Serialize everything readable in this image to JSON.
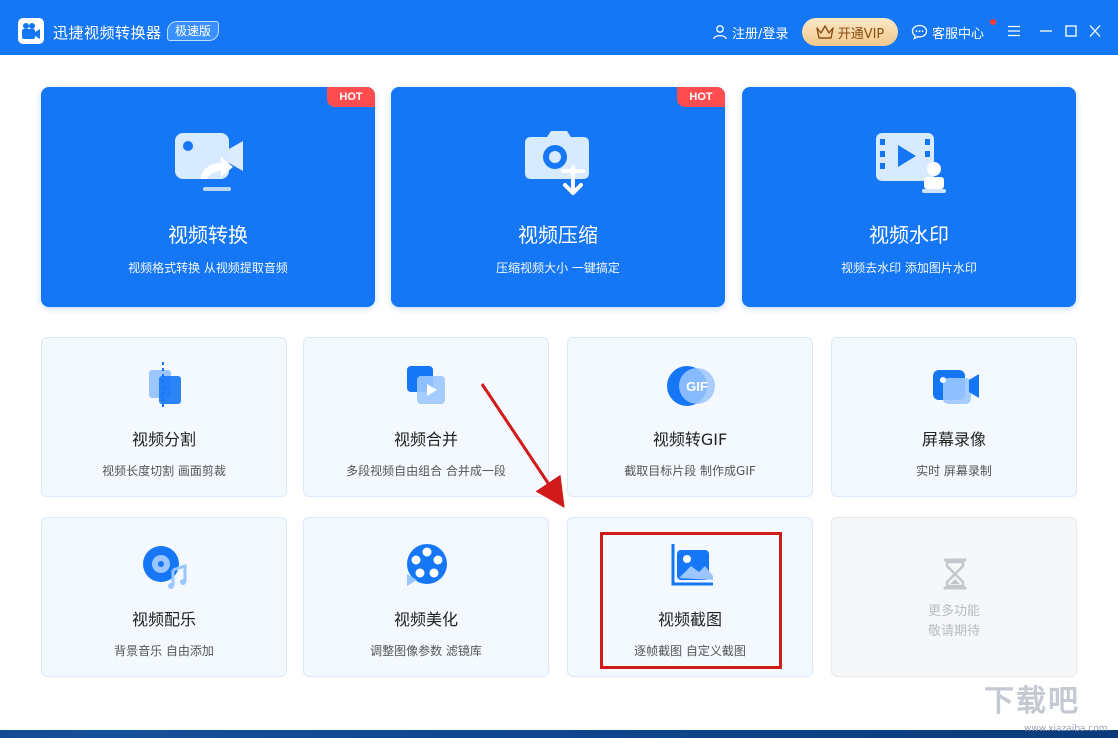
{
  "titlebar": {
    "app_name": "迅捷视频转换器",
    "badge": "极速版",
    "login": "注册/登录",
    "vip": "开通VIP",
    "service": "客服中心"
  },
  "big_cards": [
    {
      "title": "视频转换",
      "desc": "视频格式转换 从视频提取音频",
      "hot": "HOT"
    },
    {
      "title": "视频压缩",
      "desc": "压缩视频大小 一键搞定",
      "hot": "HOT"
    },
    {
      "title": "视频水印",
      "desc": "视频去水印 添加图片水印"
    }
  ],
  "small_cards": [
    {
      "title": "视频分割",
      "desc": "视频长度切割 画面剪裁"
    },
    {
      "title": "视频合并",
      "desc": "多段视频自由组合 合并成一段"
    },
    {
      "title": "视频转GIF",
      "desc": "截取目标片段 制作成GIF",
      "icon_text": "GIF"
    },
    {
      "title": "屏幕录像",
      "desc": "实时 屏幕录制"
    },
    {
      "title": "视频配乐",
      "desc": "背景音乐 自由添加"
    },
    {
      "title": "视频美化",
      "desc": "调整图像参数 滤镜库"
    },
    {
      "title": "视频截图",
      "desc": "逐帧截图 自定义截图"
    }
  ],
  "more": {
    "line1": "更多功能",
    "line2": "敬请期待"
  },
  "watermark": {
    "text": "下载吧",
    "url": "www.xiazaiba.com"
  },
  "colors": {
    "primary": "#1677f5",
    "card_bg": "#f3f9ff",
    "hot": "#ff4d4f",
    "annotation": "#d11a1a"
  }
}
